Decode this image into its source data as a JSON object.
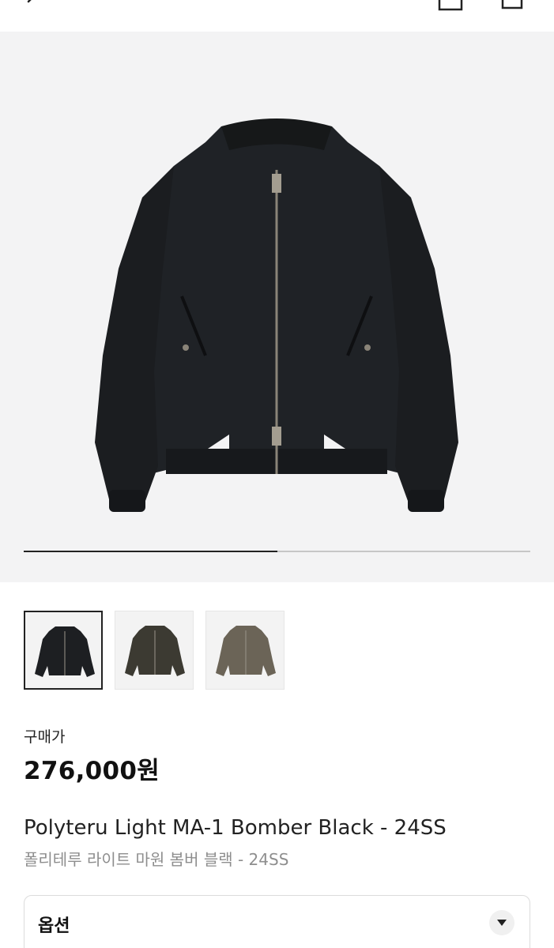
{
  "header": {
    "back_icon": "chevron-left-icon",
    "bag_icon": "shopping-bag-icon",
    "share_icon": "share-icon"
  },
  "gallery": {
    "main_image": "black-bomber-jacket",
    "progress": 0.5,
    "thumbnails": [
      {
        "color": "#1d1f22",
        "selected": true
      },
      {
        "color": "#3c3a32",
        "selected": false
      },
      {
        "color": "#6b6457",
        "selected": false
      }
    ]
  },
  "product": {
    "price_label": "구매가",
    "price": "276,000원",
    "title_en": "Polyteru Light MA-1 Bomber Black - 24SS",
    "title_ko": "폴리테루 라이트 마원 봄버 블랙 - 24SS"
  },
  "option": {
    "label": "옵션",
    "arrow_icon": "chevron-down-icon"
  }
}
